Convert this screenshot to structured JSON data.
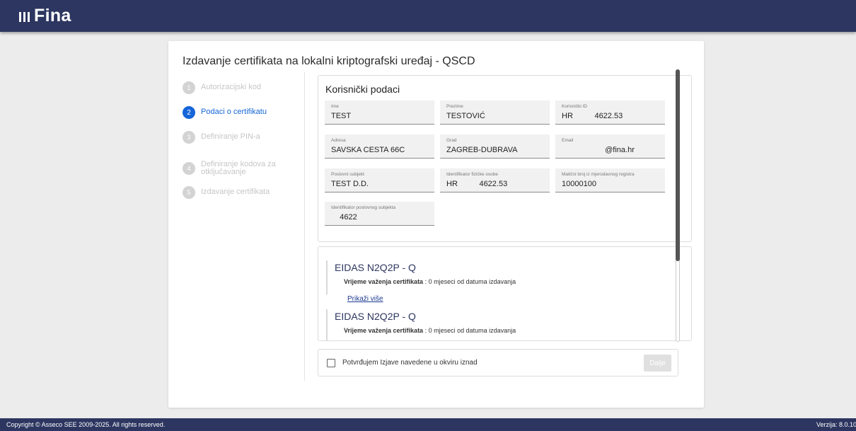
{
  "header": {
    "logo_text": "Fina"
  },
  "page_title": "Izdavanje certifikata na lokalni kriptografski uređaj - QSCD",
  "steps": [
    {
      "number": "1",
      "label": "Autorizacijski kod"
    },
    {
      "number": "2",
      "label": "Podaci o certifikatu"
    },
    {
      "number": "3",
      "label": "Definiranje PIN-a"
    },
    {
      "number": "4",
      "label": "Definiranje kodova za otključavanje"
    },
    {
      "number": "5",
      "label": "Izdavanje certifikata"
    }
  ],
  "user_data": {
    "title": "Korisnički podaci",
    "fields": [
      {
        "label": "Ime",
        "value": "TEST"
      },
      {
        "label": "Prezime",
        "value": "TESTOVIĆ"
      },
      {
        "label": "Korisnički ID",
        "value": "HR          4622.53"
      },
      {
        "label": "Adresa",
        "value": "SAVSKA CESTA 66C"
      },
      {
        "label": "Grad",
        "value": "ZAGREB-DUBRAVA"
      },
      {
        "label": "Email",
        "value": "                    @fina.hr"
      },
      {
        "label": "Poslovni subjekt",
        "value": "TEST D.D."
      },
      {
        "label": "Identifikator fizičke osobe",
        "value": "HR          4622.53"
      },
      {
        "label": "Matični broj iz mjerodavnog registra",
        "value": "10000100"
      },
      {
        "label": "Identifikator poslovnog subjekta",
        "value": "    4622"
      }
    ]
  },
  "certificates": [
    {
      "title": "EIDAS N2Q2P - Q",
      "validity_label": "Vrijeme važenja certifikata",
      "validity_value": " : 0 mjeseci od datuma izdavanja",
      "link": "Prikaži više"
    },
    {
      "title": "EIDAS N2Q2P - Q",
      "validity_label": "Vrijeme važenja certifikata",
      "validity_value": " : 0 mjeseci od datuma izdavanja"
    }
  ],
  "confirm": {
    "label": "Potvrđujem Izjave navedene u okviru iznad",
    "checked": false,
    "next_button": "Dalje"
  },
  "footer": {
    "copyright": "Copyright © Asseco SEE 2009-2025. All rights reserved.",
    "version": "Verzija: 8.0.10"
  },
  "colors": {
    "brand_navy": "#2c3660",
    "active_blue": "#1565d8",
    "inactive_gray": "#c6c6c6"
  }
}
